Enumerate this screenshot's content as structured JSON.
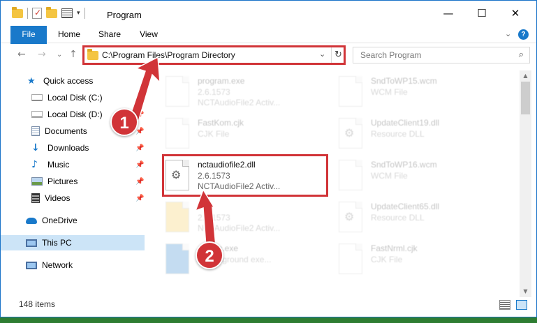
{
  "window": {
    "title": "Program"
  },
  "ribbon": {
    "tabs": [
      "File",
      "Home",
      "Share",
      "View"
    ]
  },
  "address": {
    "path": "C:\\Program Files\\Program Directory"
  },
  "search": {
    "placeholder": "Search Program"
  },
  "sidebar": {
    "items": [
      {
        "label": "Quick access",
        "icon": "star-icon",
        "pinned": false
      },
      {
        "label": "Local Disk (C:)",
        "icon": "drive-icon",
        "pinned": true
      },
      {
        "label": "Local Disk (D:)",
        "icon": "drive-icon",
        "pinned": true
      },
      {
        "label": "Documents",
        "icon": "documents-icon",
        "pinned": true
      },
      {
        "label": "Downloads",
        "icon": "download-icon",
        "pinned": true
      },
      {
        "label": "Music",
        "icon": "music-icon",
        "pinned": true
      },
      {
        "label": "Pictures",
        "icon": "pictures-icon",
        "pinned": true
      },
      {
        "label": "Videos",
        "icon": "videos-icon",
        "pinned": true
      },
      {
        "label": "OneDrive",
        "icon": "cloud-icon",
        "pinned": false
      },
      {
        "label": "This PC",
        "icon": "pc-icon",
        "pinned": false,
        "selected": true
      },
      {
        "label": "Network",
        "icon": "network-icon",
        "pinned": false
      }
    ]
  },
  "files": [
    {
      "name": "program.exe",
      "line2": "2.6.1573",
      "line3": "NCTAudioFile2 Activ...",
      "faded": true
    },
    {
      "name": "SndToWP15.wcm",
      "line2": "WCM File",
      "line3": "",
      "faded": true
    },
    {
      "name": "FastKom.cjk",
      "line2": "CJK File",
      "line3": "",
      "faded": true
    },
    {
      "name": "UpdateClient19.dll",
      "line2": "Resource DLL",
      "line3": "",
      "faded": true
    },
    {
      "name": "nctaudiofile2.dll",
      "line2": "2.6.1573",
      "line3": "NCTAudioFile2 Activ...",
      "faded": false
    },
    {
      "name": "SndToWP16.wcm",
      "line2": "WCM File",
      "line3": "",
      "faded": true
    },
    {
      "name": "",
      "line2": "2.6.1573",
      "line3": "NCTAudioFile2 Activ...",
      "faded": true
    },
    {
      "name": "UpdateClient65.dll",
      "line2": "Resource DLL",
      "line3": "",
      "faded": true
    },
    {
      "name": "...exec.exe",
      "line2": "...background exe...",
      "line3": "",
      "faded": true
    },
    {
      "name": "FastNrml.cjk",
      "line2": "CJK File",
      "line3": "",
      "faded": true
    }
  ],
  "status": {
    "item_count": "148 items"
  },
  "annotations": {
    "step1": "1",
    "step2": "2",
    "color": "#d13438"
  }
}
